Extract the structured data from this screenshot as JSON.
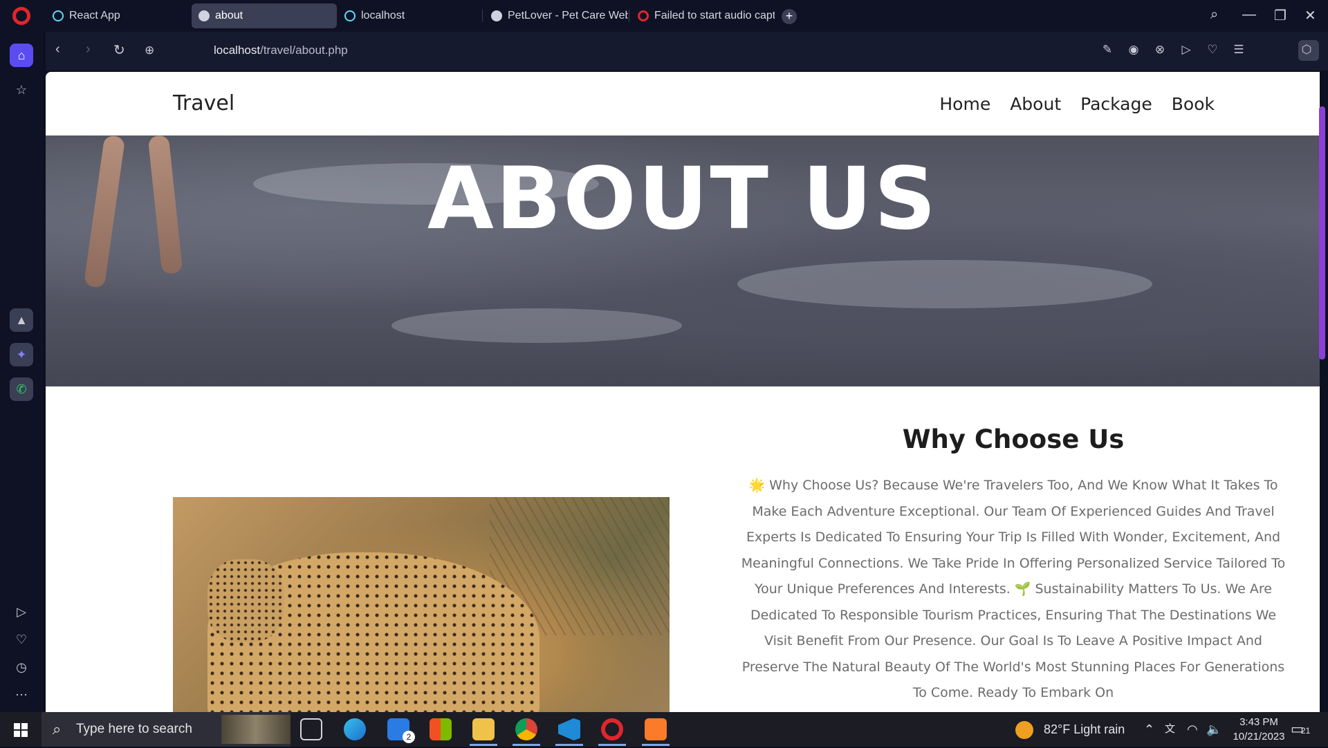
{
  "browser": {
    "tabs": [
      {
        "title": "React App",
        "active": false
      },
      {
        "title": "about",
        "active": true
      },
      {
        "title": "localhost",
        "active": false
      },
      {
        "title": "PetLover - Pet Care Websi",
        "active": false
      },
      {
        "title": "Failed to start audio captu",
        "active": false
      }
    ],
    "url_host": "localhost",
    "url_path": "/travel/about.php"
  },
  "site": {
    "brand": "Travel",
    "nav": [
      "Home",
      "About",
      "Package",
      "Book"
    ],
    "hero_title": "ABOUT US",
    "section_title": "Why Choose Us",
    "section_text": "🌟 Why Choose Us? Because We're Travelers Too, And We Know What It Takes To Make Each Adventure Exceptional. Our Team Of Experienced Guides And Travel Experts Is Dedicated To Ensuring Your Trip Is Filled With Wonder, Excitement, And Meaningful Connections. We Take Pride In Offering Personalized Service Tailored To Your Unique Preferences And Interests. 🌱 Sustainability Matters To Us. We Are Dedicated To Responsible Tourism Practices, Ensuring That The Destinations We Visit Benefit From Our Presence. Our Goal Is To Leave A Positive Impact And Preserve The Natural Beauty Of The World's Most Stunning Places For Generations To Come. Ready To Embark On"
  },
  "taskbar": {
    "search_placeholder": "Type here to search",
    "mail_badge": "2",
    "weather": "82°F  Light rain",
    "time": "3:43 PM",
    "date": "10/21/2023",
    "notifications": "21"
  },
  "colors": {
    "accent": "#5b4cf2",
    "scrollbar": "#8a3fd6",
    "opera_red": "#e0262d"
  }
}
